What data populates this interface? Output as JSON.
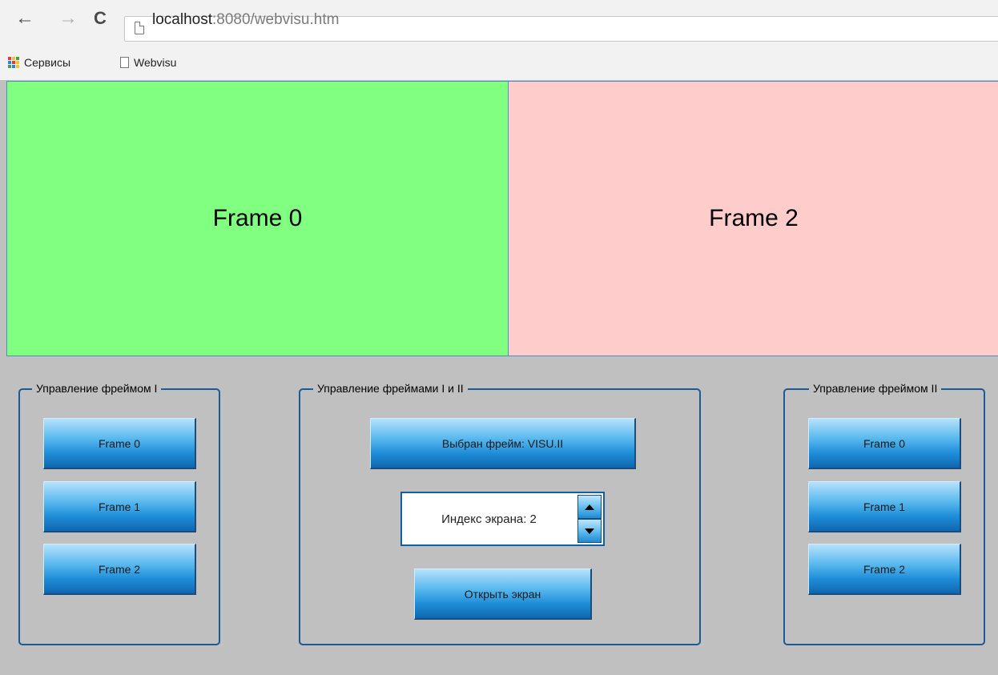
{
  "browser": {
    "url_host": "localhost",
    "url_rest": ":8080/webvisu.htm",
    "back_glyph": "←",
    "forward_glyph": "→",
    "reload_glyph": "C",
    "bookmarks": [
      {
        "label": "Сервисы",
        "icon": "apps-grid-icon"
      },
      {
        "label": "Webvisu",
        "icon": "page-icon"
      }
    ],
    "apps_colors": [
      "#e53935",
      "#fbc02d",
      "#43a047",
      "#1e88e5",
      "#e53935",
      "#fbc02d",
      "#43a047",
      "#1e88e5",
      "#fbc02d"
    ]
  },
  "frames": {
    "left": {
      "label": "Frame 0",
      "color": "#80ff80"
    },
    "right": {
      "label": "Frame 2",
      "color": "#ffcccc"
    }
  },
  "group1": {
    "legend": "Управление фреймом I",
    "buttons": [
      "Frame 0",
      "Frame 1",
      "Frame 2"
    ]
  },
  "group2": {
    "legend": "Управление фреймами I и II",
    "selected_button": "Выбран фрейм: VISU.II",
    "spin_value": "Индекс экрана: 2",
    "open_button": "Открыть экран"
  },
  "group3": {
    "legend": "Управление фреймом II",
    "buttons": [
      "Frame 0",
      "Frame 1",
      "Frame 2"
    ]
  }
}
